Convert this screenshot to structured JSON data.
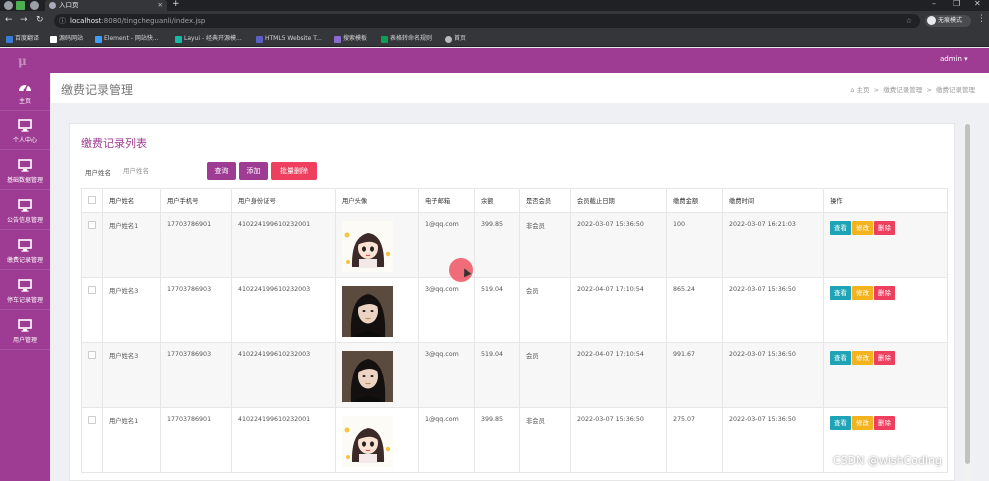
{
  "browser": {
    "tab_title": "入口页",
    "url_host": "localhost",
    "url_path": ":8080/tingcheguanli/index.jsp",
    "incognito_label": "无痕模式",
    "bookmarks": [
      {
        "label": "百度翻译",
        "color": "#3a7bd5"
      },
      {
        "label": "源码网站",
        "color": "#ffffff"
      },
      {
        "label": "Element - 网站快...",
        "color": "#409eff"
      },
      {
        "label": "Layui - 经典开源模...",
        "color": "#16baaa"
      },
      {
        "label": "HTML5 Website T...",
        "color": "#5b5fc7"
      },
      {
        "label": "搜索模板",
        "color": "#8a6bd1"
      },
      {
        "label": "表格转命名规则",
        "color": "#0f9d58"
      },
      {
        "label": "首页",
        "color": "#bbbbbb"
      }
    ]
  },
  "app": {
    "logo": "μ",
    "user": "admin ▾",
    "sidebar": [
      {
        "label": "主页",
        "icon": "dashboard-icon"
      },
      {
        "label": "个人中心",
        "icon": "monitor-icon"
      },
      {
        "label": "基础数据管理",
        "icon": "monitor-icon"
      },
      {
        "label": "公告信息管理",
        "icon": "monitor-icon"
      },
      {
        "label": "缴费记录管理",
        "icon": "monitor-icon"
      },
      {
        "label": "停车记录管理",
        "icon": "monitor-icon"
      },
      {
        "label": "用户管理",
        "icon": "monitor-icon"
      }
    ],
    "page_title": "缴费记录管理",
    "breadcrumb": {
      "home": "主页",
      "sep": ">",
      "c1": "缴费记录管理",
      "c2": "缴费记录管理"
    }
  },
  "list": {
    "title": "缴费记录列表",
    "search_label": "用户姓名",
    "search_placeholder": "用户姓名",
    "btn_search": "查询",
    "btn_add": "添加",
    "btn_batch_delete": "批量删除",
    "colors": {
      "primary": "#9e3b93",
      "danger": "#ef3f5f",
      "view": "#1ea4b6",
      "edit": "#f2b31f"
    },
    "columns": [
      "用户姓名",
      "用户手机号",
      "用户身份证号",
      "用户头像",
      "电子邮箱",
      "余额",
      "是否会员",
      "会员截止日期",
      "缴费金额",
      "缴费时间",
      "操作"
    ],
    "actions": {
      "view": "查看",
      "edit": "修改",
      "delete": "删除"
    },
    "rows": [
      {
        "name": "用户姓名1",
        "phone": "17703786901",
        "idcard": "410224199610232001",
        "avatar": "cartoon-girl",
        "email": "1@qq.com",
        "balance": "399.85",
        "member": "非会员",
        "member_end": "2022-03-07 15:36:50",
        "amount": "100",
        "pay_time": "2022-03-07 16:21:03"
      },
      {
        "name": "用户姓名3",
        "phone": "17703786903",
        "idcard": "410224199610232003",
        "avatar": "photo-woman",
        "email": "3@qq.com",
        "balance": "519.04",
        "member": "会员",
        "member_end": "2022-04-07 17:10:54",
        "amount": "865.24",
        "pay_time": "2022-03-07 15:36:50"
      },
      {
        "name": "用户姓名3",
        "phone": "17703786903",
        "idcard": "410224199610232003",
        "avatar": "photo-woman",
        "email": "3@qq.com",
        "balance": "519.04",
        "member": "会员",
        "member_end": "2022-04-07 17:10:54",
        "amount": "991.67",
        "pay_time": "2022-03-07 15:36:50"
      },
      {
        "name": "用户姓名1",
        "phone": "17703786901",
        "idcard": "410224199610232001",
        "avatar": "cartoon-girl",
        "email": "1@qq.com",
        "balance": "399.85",
        "member": "非会员",
        "member_end": "2022-03-07 15:36:50",
        "amount": "275.07",
        "pay_time": "2022-03-07 15:36:50"
      }
    ]
  },
  "watermark": "CSDN @wishCoding"
}
